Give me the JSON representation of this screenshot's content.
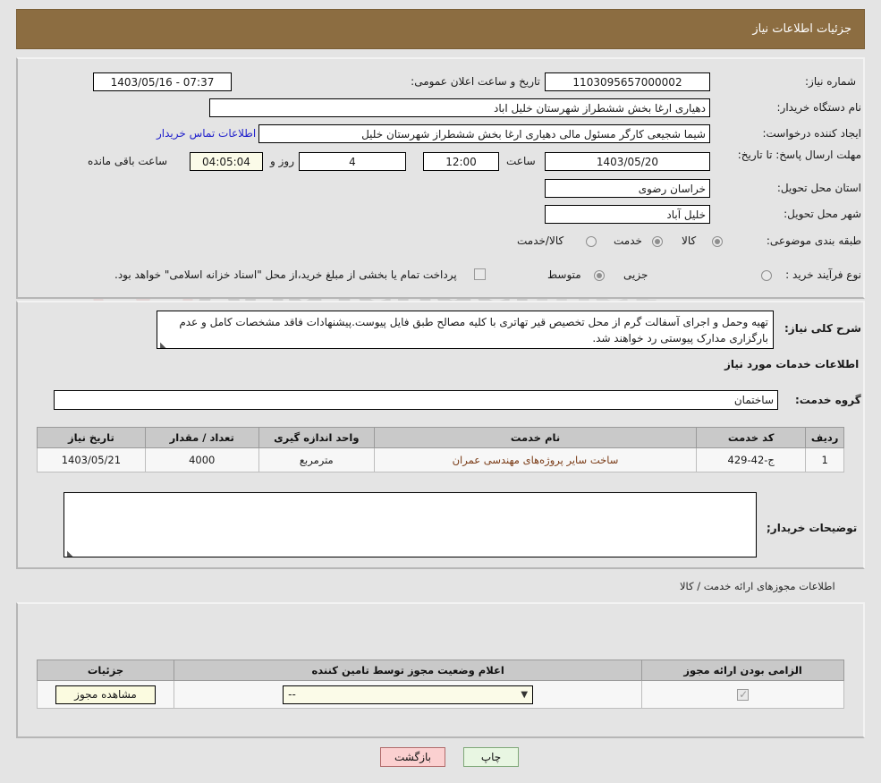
{
  "header": {
    "title": "جزئیات اطلاعات نیاز"
  },
  "watermark": {
    "text": "AriaTender",
    "suffix": ".net"
  },
  "colors": {
    "header_bar": "#8c6d41",
    "page_background": "#e4e4e4",
    "link": "#2222cc",
    "service_name": "#7a3b16",
    "back_button": "#fbd0d0",
    "print_button": "#e8f6e2",
    "highlight_field": "#fbfbe8"
  },
  "form": {
    "need_number_label": "شماره نیاز:",
    "need_number_value": "1103095657000002",
    "announce_datetime_label": "تاریخ و ساعت اعلان عمومی:",
    "announce_datetime_value": "1403/05/16 - 07:37",
    "buyer_org_label": "نام دستگاه خریدار:",
    "buyer_org_value": "دهیاری ارغا بخش ششطراز شهرستان خلیل اباد",
    "requester_label": "ایجاد کننده درخواست:",
    "requester_value": "شیما شجیعی کارگر مسئول مالی دهیاری ارغا بخش ششطراز شهرستان خلیل",
    "buyer_contact_link": "اطلاعات تماس خریدار",
    "deadline_label": "مهلت ارسال پاسخ: تا تاریخ:",
    "deadline_date": "1403/05/20",
    "deadline_time_label": "ساعت",
    "deadline_time": "12:00",
    "remaining_days": "4",
    "remaining_days_label": "روز و",
    "remaining_hours": "04:05:04",
    "remaining_hours_label": "ساعت باقی مانده",
    "province_label": "استان محل تحویل:",
    "province_value": "خراسان رضوی",
    "city_label": "شهر محل تحویل:",
    "city_value": "خلیل آباد",
    "category_label": "طبقه بندی موضوعی:",
    "category_options": [
      {
        "label": "کالا",
        "selected": false
      },
      {
        "label": "خدمت",
        "selected": true
      },
      {
        "label": "کالا/خدمت",
        "selected": false
      }
    ],
    "process_type_label": "نوع فرآیند خرید :",
    "process_type_options": [
      {
        "label": "جزیی",
        "selected": false
      },
      {
        "label": "متوسط",
        "selected": true
      },
      {
        "label": "",
        "selected": false
      }
    ],
    "treasury_checkbox_checked": false,
    "treasury_note": "پرداخت تمام یا بخشی از مبلغ خرید،از محل \"اسناد خزانه اسلامی\" خواهد بود."
  },
  "description": {
    "need_summary_label": "شرح کلی نیاز:",
    "need_summary_value": "تهیه وحمل و اجرای آسفالت گرم از محل تخصیص قیر تهاتری با کلیه مصالح طبق فایل پیوست.پیشنهادات فاقد مشخصات کامل و عدم بارگزاری مدارک پیوستی رد خواهند شد.",
    "services_section_title": "اطلاعات خدمات مورد نیاز",
    "service_group_label": "گروه خدمت:",
    "service_group_value": "ساختمان",
    "buyer_notes_label": "توضیحات خریدار;",
    "buyer_notes_value": ""
  },
  "services_table": {
    "columns": [
      "ردیف",
      "کد خدمت",
      "نام خدمت",
      "واحد اندازه گیری",
      "تعداد / مقدار",
      "تاریخ نیاز"
    ],
    "rows": [
      {
        "row": "1",
        "code": "ج-42-429",
        "name": "ساخت سایر پروژه‌های مهندسی عمران",
        "unit": "مترمربع",
        "quantity": "4000",
        "need_date": "1403/05/21"
      }
    ]
  },
  "permits": {
    "section_title": "اطلاعات مجوزهای ارائه خدمت / کالا",
    "columns": [
      "الزامی بودن ارائه مجوز",
      "اعلام وضعیت مجوز توسط تامین کننده",
      "جزئیات"
    ],
    "rows": [
      {
        "required_checked": true,
        "status_value": "--",
        "details_button": "مشاهده مجوز"
      }
    ]
  },
  "footer": {
    "back_button": "بازگشت",
    "print_button": "چاپ"
  }
}
